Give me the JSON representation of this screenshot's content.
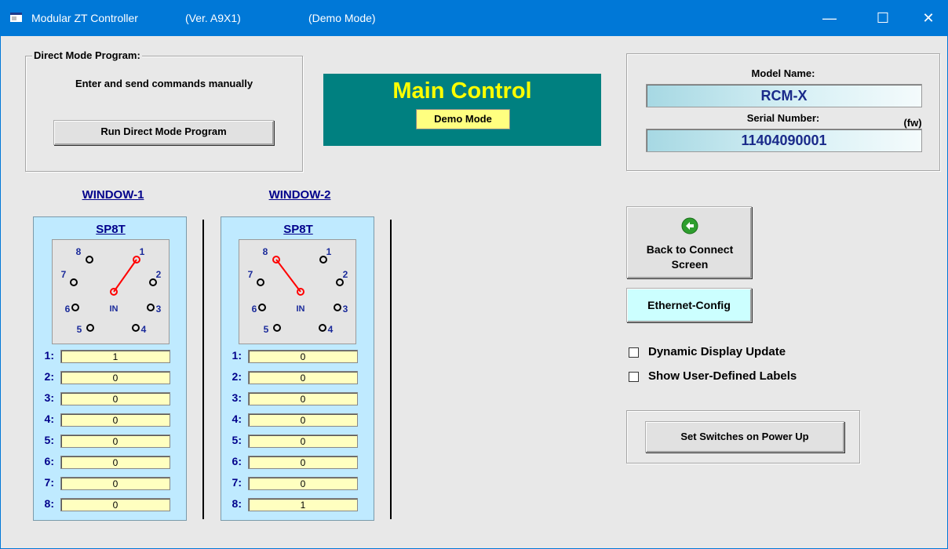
{
  "titlebar": {
    "app_title": "Modular ZT Controller",
    "version": "(Ver. A9X1)",
    "mode": "(Demo Mode)"
  },
  "direct_mode": {
    "legend": "Direct Mode Program:",
    "description": "Enter and send commands manually",
    "button": "Run Direct Mode Program"
  },
  "main_control": {
    "title": "Main Control",
    "badge": "Demo Mode"
  },
  "model": {
    "model_name_label": "Model Name:",
    "model_name": "RCM-X",
    "serial_label": "Serial Number:",
    "fw_label": "(fw)",
    "serial_number": "11404090001"
  },
  "windows": [
    {
      "header": "WINDOW-1",
      "switch_type": "SP8T",
      "in_label": "IN",
      "active_port": 1,
      "port_labels": [
        "1",
        "2",
        "3",
        "4",
        "5",
        "6",
        "7",
        "8"
      ],
      "rows": [
        {
          "label": "1:",
          "value": "1"
        },
        {
          "label": "2:",
          "value": "0"
        },
        {
          "label": "3:",
          "value": "0"
        },
        {
          "label": "4:",
          "value": "0"
        },
        {
          "label": "5:",
          "value": "0"
        },
        {
          "label": "6:",
          "value": "0"
        },
        {
          "label": "7:",
          "value": "0"
        },
        {
          "label": "8:",
          "value": "0"
        }
      ]
    },
    {
      "header": "WINDOW-2",
      "switch_type": "SP8T",
      "in_label": "IN",
      "active_port": 8,
      "port_labels": [
        "1",
        "2",
        "3",
        "4",
        "5",
        "6",
        "7",
        "8"
      ],
      "rows": [
        {
          "label": "1:",
          "value": "0"
        },
        {
          "label": "2:",
          "value": "0"
        },
        {
          "label": "3:",
          "value": "0"
        },
        {
          "label": "4:",
          "value": "0"
        },
        {
          "label": "5:",
          "value": "0"
        },
        {
          "label": "6:",
          "value": "0"
        },
        {
          "label": "7:",
          "value": "0"
        },
        {
          "label": "8:",
          "value": "1"
        }
      ]
    }
  ],
  "actions": {
    "back_button": "Back to Connect Screen",
    "ethernet_button": "Ethernet-Config",
    "dynamic_update": "Dynamic Display Update",
    "dynamic_update_checked": false,
    "user_labels": "Show User-Defined Labels",
    "user_labels_checked": false,
    "power_up_button": "Set Switches on Power Up"
  },
  "colors": {
    "titlebar": "#0078d7",
    "main_panel": "#008080",
    "main_title": "#ffff00",
    "window_panel": "#bfeaff",
    "active_switch": "#ff0000"
  }
}
